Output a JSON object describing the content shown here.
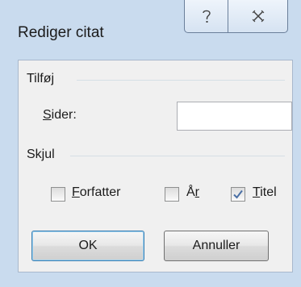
{
  "window": {
    "title": "Rediger citat",
    "help_icon": "question-mark-icon",
    "close_icon": "close-x-icon"
  },
  "add_section": {
    "label": "Tilføj",
    "pages_label_first": "S",
    "pages_label_rest": "ider:",
    "pages_value": "",
    "pages_placeholder": ""
  },
  "hide_section": {
    "label": "Skjul",
    "author": {
      "label_first": "F",
      "label_rest": "orfatter",
      "checked": false
    },
    "year": {
      "label_first": "Å",
      "label_rest": "r",
      "checked": false
    },
    "title": {
      "label_first": "T",
      "label_rest": "itel",
      "checked": true
    }
  },
  "buttons": {
    "ok": "OK",
    "cancel": "Annuller"
  },
  "colors": {
    "frame": "#c9dbee",
    "client": "#f0f0f0",
    "focus_border": "#3c7fb1",
    "check_mark": "#4a6fa5"
  }
}
